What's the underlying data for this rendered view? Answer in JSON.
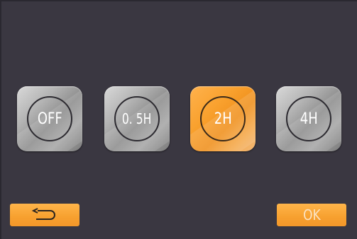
{
  "options": [
    {
      "label": "OFF",
      "selected": false
    },
    {
      "label": "0. 5H",
      "selected": false
    },
    {
      "label": "2H",
      "selected": true
    },
    {
      "label": "4H",
      "selected": false
    }
  ],
  "buttons": {
    "back_icon": "return-arrow-icon",
    "ok_label": "OK"
  },
  "colors": {
    "background": "#3a3741",
    "accent": "#f7a02f",
    "tile_grey": "#a6a6a6",
    "text": "#ffffff"
  }
}
